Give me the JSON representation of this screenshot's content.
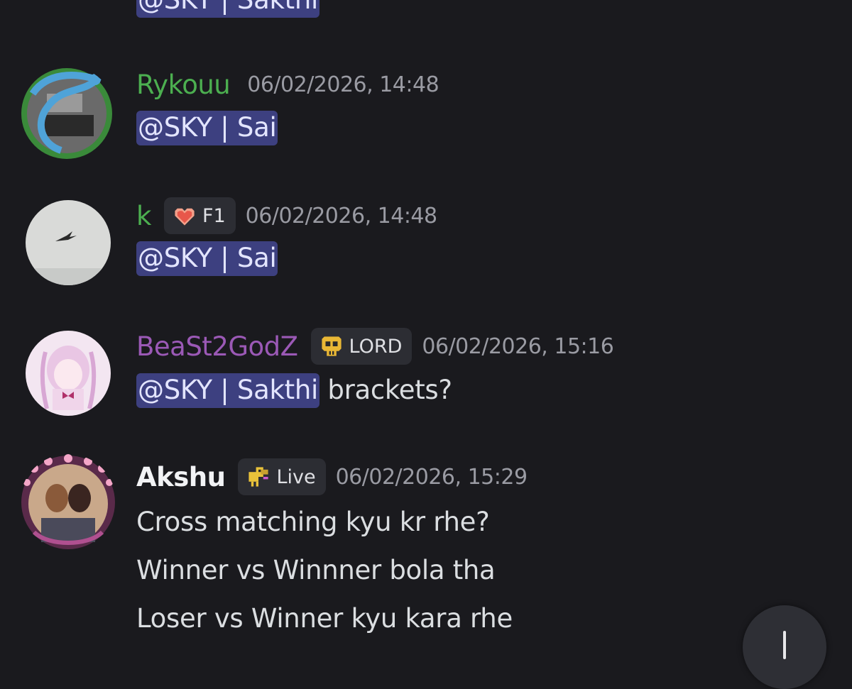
{
  "colors": {
    "background": "#1a1a1e",
    "mention_bg": "#3d4080",
    "timestamp": "#9a9ba3"
  },
  "top_fragment": {
    "mention": "@SKY | Sakthi"
  },
  "messages": [
    {
      "username": "Rykouu",
      "username_color": "#4caf50",
      "timestamp": "06/02/2026, 14:48",
      "tag": null,
      "lines": [
        {
          "mention": "@SKY | Sai",
          "text": ""
        }
      ]
    },
    {
      "username": "k",
      "username_color": "#4caf50",
      "timestamp": "06/02/2026, 14:48",
      "tag": {
        "icon": "pixel-heart-icon",
        "label": "F1"
      },
      "lines": [
        {
          "mention": "@SKY | Sai",
          "text": ""
        }
      ]
    },
    {
      "username": "BeaSt2GodZ",
      "username_color": "#9b59b6",
      "timestamp": "06/02/2026, 15:16",
      "tag": {
        "icon": "skull-icon",
        "label": "LORD"
      },
      "lines": [
        {
          "mention": "@SKY | Sakthi",
          "text": " brackets?"
        }
      ]
    },
    {
      "username": "Akshu",
      "username_color": "#f2f3f5",
      "timestamp": "06/02/2026, 15:29",
      "tag": {
        "icon": "pixel-dog-icon",
        "label": "Live"
      },
      "lines": [
        {
          "mention": "",
          "text": "Cross matching kyu kr rhe?"
        },
        {
          "mention": "",
          "text": "Winner vs Winnner bola tha"
        },
        {
          "mention": "",
          "text": "Loser vs Winner kyu kara rhe"
        }
      ]
    }
  ],
  "scroll_button": {
    "icon": "arrow-down-icon"
  }
}
